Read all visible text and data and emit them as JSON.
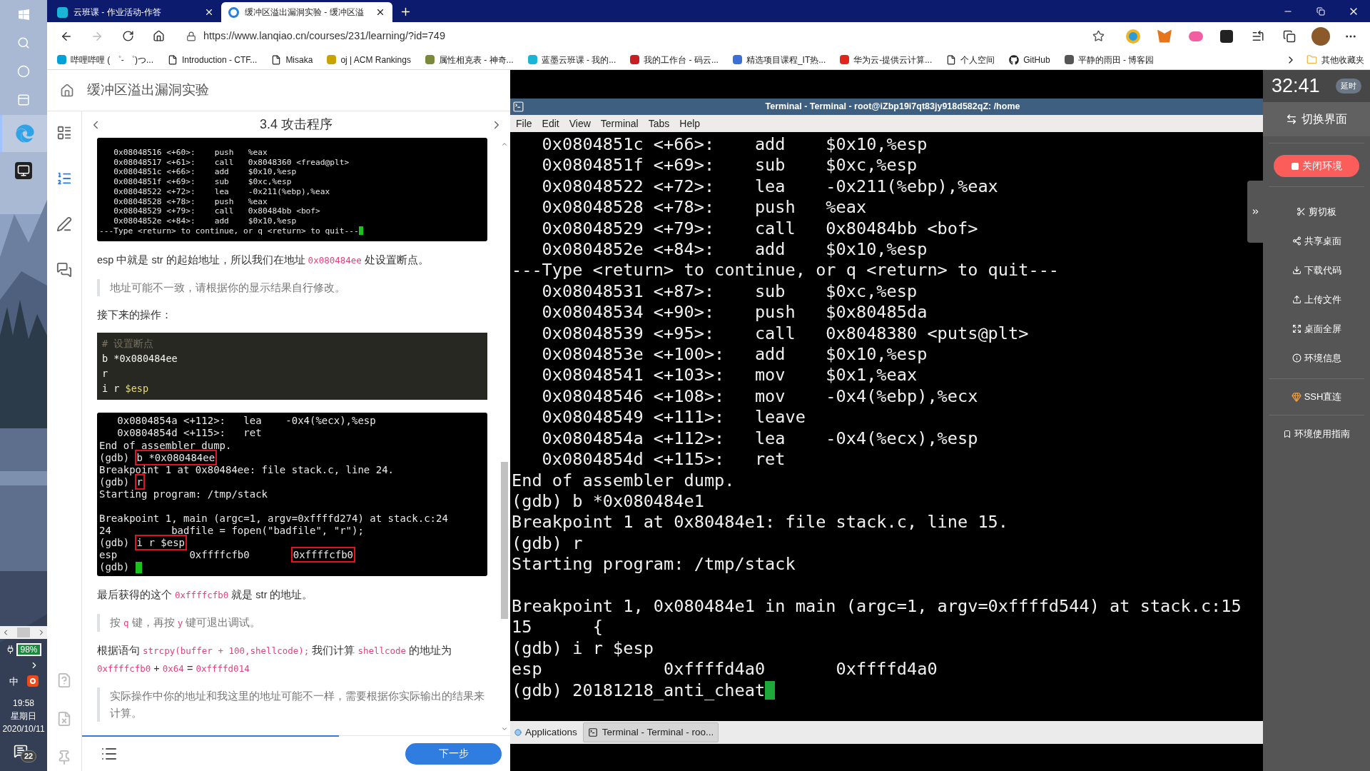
{
  "taskbar": {
    "apps": [
      {
        "kind": "edge",
        "selected": true
      },
      {
        "kind": "remote",
        "selected": false
      }
    ],
    "battery": "98%",
    "ime": "中",
    "clock": {
      "time": "19:58",
      "weekday": "星期日",
      "date": "2020/10/11"
    },
    "notifications": "22"
  },
  "browser": {
    "tabs": [
      {
        "title": "云班课 - 作业活动-作答",
        "selected": false
      },
      {
        "title": "缓冲区溢出漏洞实验 - 缓冲区溢",
        "selected": true
      }
    ],
    "url": "https://www.lanqiao.cn/courses/231/learning/?id=749",
    "bookmarks": [
      {
        "label": "哔哩哔哩 ( ゜- ゜)つ...",
        "kind": "site",
        "color": "#00a1d6"
      },
      {
        "label": "Introduction - CTF...",
        "kind": "page"
      },
      {
        "label": "Misaka",
        "kind": "page"
      },
      {
        "label": "oj | ACM Rankings",
        "kind": "site",
        "color": "#c9a400"
      },
      {
        "label": "属性相克表 - 神奇...",
        "kind": "site",
        "color": "#7a8a3a"
      },
      {
        "label": "蓝墨云班课 - 我的...",
        "kind": "site",
        "color": "#19b4d6"
      },
      {
        "label": "我的工作台 - 码云...",
        "kind": "site",
        "color": "#c71d23"
      },
      {
        "label": "精选项目课程_IT热...",
        "kind": "site",
        "color": "#3a6fd8"
      },
      {
        "label": "华为云-提供云计算...",
        "kind": "site",
        "color": "#e0251b"
      },
      {
        "label": "个人空间",
        "kind": "page"
      },
      {
        "label": "GitHub",
        "kind": "github"
      },
      {
        "label": "平静的雨田 - 博客园",
        "kind": "site",
        "color": "#555555"
      }
    ],
    "other_bookmarks": "其他收藏夹"
  },
  "lesson": {
    "title": "缓冲区溢出漏洞实验",
    "section": "3.4 攻击程序",
    "rail": [
      {
        "kind": "outline",
        "selected": false
      },
      {
        "kind": "steps",
        "selected": true
      },
      {
        "kind": "notes",
        "selected": false
      },
      {
        "kind": "comments",
        "selected": false
      },
      {
        "kind": "question",
        "selected": false
      },
      {
        "kind": "report",
        "selected": false
      },
      {
        "kind": "pin",
        "selected": false
      }
    ],
    "blocks": [
      {
        "kind": "screenshot",
        "lines": [
          {
            "kind": "text",
            "text": "   0x08048516 <+60>:    push   %eax"
          },
          {
            "kind": "text",
            "text": "   0x08048517 <+61>:    call   0x8048360 <fread@plt>"
          },
          {
            "kind": "text",
            "text": "   0x0804851c <+66>:    add    $0x10,%esp"
          },
          {
            "kind": "text",
            "text": "   0x0804851f <+69>:    sub    $0xc,%esp"
          },
          {
            "kind": "text",
            "text": "   0x08048522 <+72>:    lea    -0x211(%ebp),%eax"
          },
          {
            "kind": "text",
            "text": "   0x08048528 <+78>:    push   %eax"
          },
          {
            "kind": "text",
            "text": "   0x08048529 <+79>:    call   0x80484bb <bof>"
          },
          {
            "kind": "text",
            "text": "   0x0804852e <+84>:    add    $0x10,%esp"
          },
          {
            "kind": "text",
            "text": "---Type <return> to continue, or q <return> to quit---"
          }
        ]
      },
      {
        "kind": "paragraph",
        "parts": [
          {
            "kind": "text",
            "text": "esp 中就是 str 的起始地址，所以我们在地址 "
          },
          {
            "kind": "code",
            "text": "0x080484ee"
          },
          {
            "kind": "text",
            "text": " 处设置断点。"
          }
        ]
      },
      {
        "kind": "note",
        "parts": [
          {
            "kind": "text",
            "text": "地址可能不一致，请根据你的显示结果自行修改。"
          }
        ]
      },
      {
        "kind": "paragraph",
        "parts": [
          {
            "kind": "text",
            "text": "接下来的操作："
          }
        ]
      },
      {
        "kind": "code",
        "lines": [
          [
            {
              "kind": "comment",
              "text": "# 设置断点"
            }
          ],
          [
            {
              "kind": "plain",
              "text": "b *0x080484ee"
            }
          ],
          [
            {
              "kind": "plain",
              "text": "r"
            }
          ],
          [
            {
              "kind": "plain",
              "text": "i r "
            },
            {
              "kind": "variable",
              "text": "$esp"
            }
          ]
        ]
      },
      {
        "kind": "screenshot",
        "lines": [
          {
            "kind": "text",
            "text": "   0x0804854a <+112>:   lea    -0x4(%ecx),%esp"
          },
          {
            "kind": "text",
            "text": "   0x0804854d <+115>:   ret"
          },
          {
            "kind": "text",
            "text": "End of assembler dump."
          },
          {
            "kind": "prompt",
            "parts": [
              {
                "text": "(gdb) ",
                "boxed": false
              },
              {
                "text": "b *0x080484ee",
                "boxed": true
              }
            ]
          },
          {
            "kind": "text",
            "text": "Breakpoint 1 at 0x80484ee: file stack.c, line 24."
          },
          {
            "kind": "prompt",
            "parts": [
              {
                "text": "(gdb) ",
                "boxed": false
              },
              {
                "text": "r",
                "boxed": true
              }
            ]
          },
          {
            "kind": "text",
            "text": "Starting program: /tmp/stack"
          },
          {
            "kind": "blank"
          },
          {
            "kind": "text",
            "text": "Breakpoint 1, main (argc=1, argv=0xffffd274) at stack.c:24"
          },
          {
            "kind": "text",
            "text": "24          badfile = fopen(\"badfile\", \"r\");"
          },
          {
            "kind": "prompt",
            "parts": [
              {
                "text": "(gdb) ",
                "boxed": false
              },
              {
                "text": "i r $esp",
                "boxed": true
              }
            ]
          },
          {
            "kind": "prompt",
            "parts": [
              {
                "text": "esp            0xffffcfb0       ",
                "boxed": false
              },
              {
                "text": "0xffffcfb0",
                "boxed": true
              }
            ]
          },
          {
            "kind": "text",
            "text": "(gdb) "
          }
        ]
      },
      {
        "kind": "paragraph",
        "parts": [
          {
            "kind": "text",
            "text": "最后获得的这个 "
          },
          {
            "kind": "code",
            "text": "0xffffcfb0"
          },
          {
            "kind": "text",
            "text": " 就是 str 的地址。"
          }
        ]
      },
      {
        "kind": "note",
        "parts": [
          {
            "kind": "text",
            "text": "按 "
          },
          {
            "kind": "code",
            "text": "q"
          },
          {
            "kind": "text",
            "text": " 键，再按 "
          },
          {
            "kind": "code",
            "text": "y"
          },
          {
            "kind": "text",
            "text": " 键可退出调试。"
          }
        ]
      },
      {
        "kind": "paragraph",
        "parts": [
          {
            "kind": "text",
            "text": "根据语句 "
          },
          {
            "kind": "code",
            "text": "strcpy(buffer + 100,shellcode);"
          },
          {
            "kind": "text",
            "text": " 我们计算 "
          },
          {
            "kind": "code",
            "text": "shellcode"
          },
          {
            "kind": "text",
            "text": " 的地址为 "
          },
          {
            "kind": "code",
            "text": "0xffffcfb0"
          },
          {
            "kind": "text",
            "text": " + "
          },
          {
            "kind": "code",
            "text": "0x64"
          },
          {
            "kind": "text",
            "text": " = "
          },
          {
            "kind": "code",
            "text": "0xffffd014"
          }
        ]
      },
      {
        "kind": "note",
        "parts": [
          {
            "kind": "text",
            "text": "实际操作中你的地址和我这里的地址可能不一样，需要根据你实际输出的结果来计算。"
          }
        ]
      }
    ],
    "progress": {
      "level": 0.6
    },
    "next_button": "下一步"
  },
  "terminal": {
    "title": "Terminal - Terminal - root@iZbp19i7qt83jy918d582qZ: /home",
    "menu": [
      "File",
      "Edit",
      "View",
      "Terminal",
      "Tabs",
      "Help"
    ],
    "lines": [
      {
        "kind": "text",
        "text": "   0x0804851c <+66>:    add    $0x10,%esp"
      },
      {
        "kind": "text",
        "text": "   0x0804851f <+69>:    sub    $0xc,%esp"
      },
      {
        "kind": "text",
        "text": "   0x08048522 <+72>:    lea    -0x211(%ebp),%eax"
      },
      {
        "kind": "text",
        "text": "   0x08048528 <+78>:    push   %eax"
      },
      {
        "kind": "text",
        "text": "   0x08048529 <+79>:    call   0x80484bb <bof>"
      },
      {
        "kind": "text",
        "text": "   0x0804852e <+84>:    add    $0x10,%esp"
      },
      {
        "kind": "text",
        "text": "---Type <return> to continue, or q <return> to quit---"
      },
      {
        "kind": "text",
        "text": "   0x08048531 <+87>:    sub    $0xc,%esp"
      },
      {
        "kind": "text",
        "text": "   0x08048534 <+90>:    push   $0x80485da"
      },
      {
        "kind": "text",
        "text": "   0x08048539 <+95>:    call   0x8048380 <puts@plt>"
      },
      {
        "kind": "text",
        "text": "   0x0804853e <+100>:   add    $0x10,%esp"
      },
      {
        "kind": "text",
        "text": "   0x08048541 <+103>:   mov    $0x1,%eax"
      },
      {
        "kind": "text",
        "text": "   0x08048546 <+108>:   mov    -0x4(%ebp),%ecx"
      },
      {
        "kind": "text",
        "text": "   0x08048549 <+111>:   leave"
      },
      {
        "kind": "text",
        "text": "   0x0804854a <+112>:   lea    -0x4(%ecx),%esp"
      },
      {
        "kind": "text",
        "text": "   0x0804854d <+115>:   ret"
      },
      {
        "kind": "text",
        "text": "End of assembler dump."
      },
      {
        "kind": "text",
        "text": "(gdb) b *0x080484e1"
      },
      {
        "kind": "text",
        "text": "Breakpoint 1 at 0x80484e1: file stack.c, line 15."
      },
      {
        "kind": "text",
        "text": "(gdb) r"
      },
      {
        "kind": "text",
        "text": "Starting program: /tmp/stack"
      },
      {
        "kind": "blank"
      },
      {
        "kind": "text",
        "text": "Breakpoint 1, 0x080484e1 in main (argc=1, argv=0xffffd544) at stack.c:15"
      },
      {
        "kind": "text",
        "text": "15      {"
      },
      {
        "kind": "text",
        "text": "(gdb) i r $esp"
      },
      {
        "kind": "text",
        "text": "esp            0xffffd4a0       0xffffd4a0"
      },
      {
        "kind": "text",
        "text": "(gdb) 20181218_anti_cheat"
      }
    ],
    "panel": {
      "menu": "Applications",
      "task": "Terminal - Terminal - roo..."
    }
  },
  "sidebar": {
    "timer": "32:41",
    "extend": "延时",
    "switch": "切换界面",
    "close": "关闭环境",
    "tools": [
      {
        "kind": "clipboard",
        "label": "剪切板"
      },
      {
        "kind": "share",
        "label": "共享桌面"
      },
      {
        "kind": "download",
        "label": "下载代码"
      },
      {
        "kind": "upload",
        "label": "上传文件"
      },
      {
        "kind": "fullscreen",
        "label": "桌面全屏"
      },
      {
        "kind": "info",
        "label": "环境信息"
      }
    ],
    "ssh": "SSH直连",
    "guide": "环境使用指南"
  }
}
